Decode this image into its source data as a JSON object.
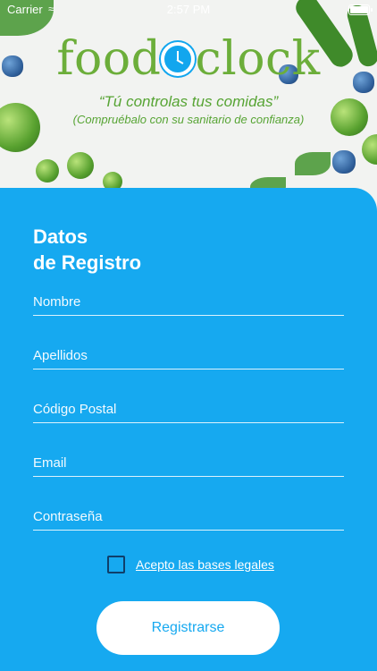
{
  "status_bar": {
    "carrier": "Carrier",
    "wifi_icon": "wifi-icon",
    "time": "2:57 PM",
    "battery_icon": "battery-icon"
  },
  "brand": {
    "logo_left": "food",
    "logo_right": "clock",
    "clock_icon": "clock-icon"
  },
  "tagline": {
    "main": "“Tú controlas tus comidas”",
    "sub": "(Compruébalo con su sanitario de confianza)"
  },
  "form": {
    "title_line1": "Datos",
    "title_line2": "de Registro",
    "fields": [
      {
        "placeholder": "Nombre",
        "value": ""
      },
      {
        "placeholder": "Apellidos",
        "value": ""
      },
      {
        "placeholder": "Código Postal",
        "value": ""
      },
      {
        "placeholder": "Email",
        "value": ""
      },
      {
        "placeholder": "Contraseña",
        "value": ""
      }
    ],
    "terms_label": "Acepto las bases legales",
    "terms_checked": false,
    "submit_label": "Registrarse"
  },
  "colors": {
    "panel_blue": "#16a9f0",
    "brand_green": "#6cae3a",
    "checkbox_border": "#0f3f6a"
  }
}
